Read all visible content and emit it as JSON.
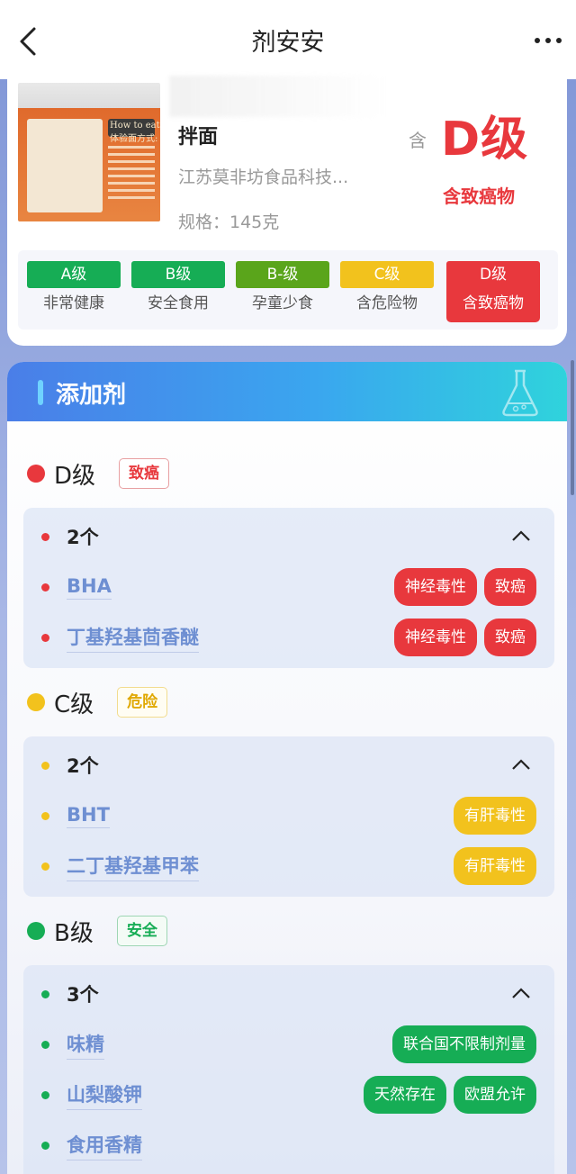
{
  "nav": {
    "title": "剂安安",
    "back_icon": "chevron-left-icon",
    "more_icon": "more-dots-icon"
  },
  "product": {
    "name": "拌面",
    "company": "江苏莫非坊食品科技...",
    "spec": "规格：145克",
    "contains_label": "含",
    "grade": "D级",
    "grade_desc": "含致癌物",
    "thumb_text": "How to eat 体验面方式:"
  },
  "legend": [
    {
      "grade": "A级",
      "desc": "非常健康",
      "color": "#16ad55",
      "active": false
    },
    {
      "grade": "B级",
      "desc": "安全食用",
      "color": "#16ad55",
      "active": false
    },
    {
      "grade": "B-级",
      "desc": "孕童少食",
      "color": "#5aa51b",
      "active": false
    },
    {
      "grade": "C级",
      "desc": "含危险物",
      "color": "#f2c21d",
      "active": false
    },
    {
      "grade": "D级",
      "desc": "含致癌物",
      "color": "#e8383d",
      "active": true
    }
  ],
  "additives": {
    "title": "添加剂",
    "groups": [
      {
        "grade": "D级",
        "badge": "致癌",
        "color": "#e8383d",
        "count": "2个",
        "items": [
          {
            "name": "BHA",
            "tags": [
              "神经毒性",
              "致癌"
            ]
          },
          {
            "name": "丁基羟基茴香醚",
            "tags": [
              "神经毒性",
              "致癌"
            ]
          }
        ]
      },
      {
        "grade": "C级",
        "badge": "危险",
        "color": "#f2c21d",
        "count": "2个",
        "items": [
          {
            "name": "BHT",
            "tags": [
              "有肝毒性"
            ]
          },
          {
            "name": "二丁基羟基甲苯",
            "tags": [
              "有肝毒性"
            ]
          }
        ]
      },
      {
        "grade": "B级",
        "badge": "安全",
        "color": "#16ad55",
        "count": "3个",
        "items": [
          {
            "name": "味精",
            "tags": [
              "联合国不限制剂量"
            ]
          },
          {
            "name": "山梨酸钾",
            "tags": [
              "天然存在",
              "欧盟允许"
            ]
          },
          {
            "name": "食用香精",
            "tags": []
          }
        ]
      }
    ]
  }
}
